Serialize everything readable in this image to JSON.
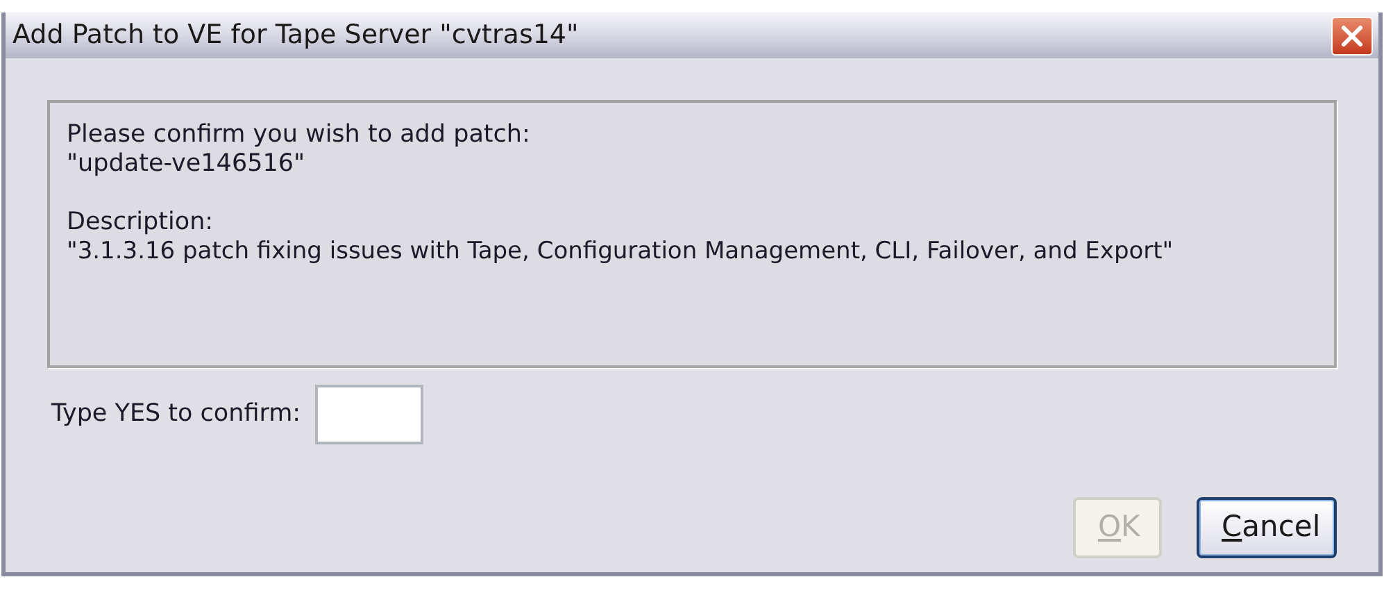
{
  "window": {
    "title": "Add Patch to VE for Tape Server \"cvtras14\""
  },
  "message": {
    "prompt": "Please confirm you wish to add patch:",
    "patch_name": "\"update-ve146516\"",
    "description_label": "Description:",
    "description": "\"3.1.3.16 patch fixing issues with Tape, Configuration Management, CLI, Failover, and Export\""
  },
  "confirm_field": {
    "label": "Type YES to confirm:"
  },
  "buttons": [
    {
      "label": "OK",
      "disabled": true,
      "focused": false
    },
    {
      "label": "Cancel",
      "disabled": false,
      "focused": true
    }
  ]
}
